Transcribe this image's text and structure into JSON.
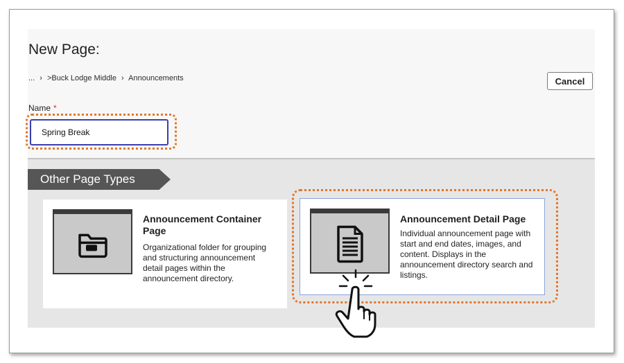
{
  "header": {
    "title": "New Page:",
    "breadcrumb": [
      "...",
      ">Buck Lodge Middle",
      "Announcements"
    ],
    "breadcrumb_separator": "›",
    "cancel_label": "Cancel"
  },
  "name_field": {
    "label": "Name",
    "required_marker": "*",
    "value": "Spring Break"
  },
  "section": {
    "title": "Other Page Types"
  },
  "page_types": [
    {
      "title": "Announcement Container Page",
      "description": "Organizational folder for grouping and structuring announcement detail pages within the announcement directory.",
      "icon": "folder-icon"
    },
    {
      "title": "Announcement Detail Page",
      "description": "Individual announcement page with start and end dates, images, and content. Displays in the announcement directory search and listings.",
      "icon": "document-icon"
    }
  ],
  "colors": {
    "highlight": "#e0772a",
    "input_border": "#3b3fb0",
    "required": "#d32f2f",
    "section_tab": "#565656"
  }
}
